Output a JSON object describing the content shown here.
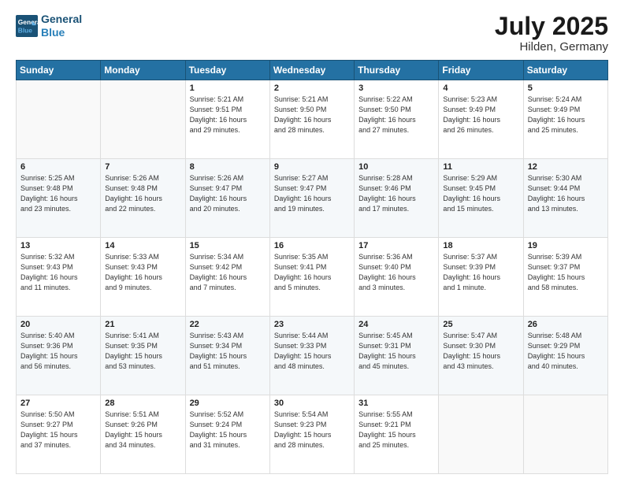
{
  "logo": {
    "line1": "General",
    "line2": "Blue"
  },
  "title": "July 2025",
  "location": "Hilden, Germany",
  "days_header": [
    "Sunday",
    "Monday",
    "Tuesday",
    "Wednesday",
    "Thursday",
    "Friday",
    "Saturday"
  ],
  "weeks": [
    [
      {
        "day": "",
        "content": ""
      },
      {
        "day": "",
        "content": ""
      },
      {
        "day": "1",
        "content": "Sunrise: 5:21 AM\nSunset: 9:51 PM\nDaylight: 16 hours\nand 29 minutes."
      },
      {
        "day": "2",
        "content": "Sunrise: 5:21 AM\nSunset: 9:50 PM\nDaylight: 16 hours\nand 28 minutes."
      },
      {
        "day": "3",
        "content": "Sunrise: 5:22 AM\nSunset: 9:50 PM\nDaylight: 16 hours\nand 27 minutes."
      },
      {
        "day": "4",
        "content": "Sunrise: 5:23 AM\nSunset: 9:49 PM\nDaylight: 16 hours\nand 26 minutes."
      },
      {
        "day": "5",
        "content": "Sunrise: 5:24 AM\nSunset: 9:49 PM\nDaylight: 16 hours\nand 25 minutes."
      }
    ],
    [
      {
        "day": "6",
        "content": "Sunrise: 5:25 AM\nSunset: 9:48 PM\nDaylight: 16 hours\nand 23 minutes."
      },
      {
        "day": "7",
        "content": "Sunrise: 5:26 AM\nSunset: 9:48 PM\nDaylight: 16 hours\nand 22 minutes."
      },
      {
        "day": "8",
        "content": "Sunrise: 5:26 AM\nSunset: 9:47 PM\nDaylight: 16 hours\nand 20 minutes."
      },
      {
        "day": "9",
        "content": "Sunrise: 5:27 AM\nSunset: 9:47 PM\nDaylight: 16 hours\nand 19 minutes."
      },
      {
        "day": "10",
        "content": "Sunrise: 5:28 AM\nSunset: 9:46 PM\nDaylight: 16 hours\nand 17 minutes."
      },
      {
        "day": "11",
        "content": "Sunrise: 5:29 AM\nSunset: 9:45 PM\nDaylight: 16 hours\nand 15 minutes."
      },
      {
        "day": "12",
        "content": "Sunrise: 5:30 AM\nSunset: 9:44 PM\nDaylight: 16 hours\nand 13 minutes."
      }
    ],
    [
      {
        "day": "13",
        "content": "Sunrise: 5:32 AM\nSunset: 9:43 PM\nDaylight: 16 hours\nand 11 minutes."
      },
      {
        "day": "14",
        "content": "Sunrise: 5:33 AM\nSunset: 9:43 PM\nDaylight: 16 hours\nand 9 minutes."
      },
      {
        "day": "15",
        "content": "Sunrise: 5:34 AM\nSunset: 9:42 PM\nDaylight: 16 hours\nand 7 minutes."
      },
      {
        "day": "16",
        "content": "Sunrise: 5:35 AM\nSunset: 9:41 PM\nDaylight: 16 hours\nand 5 minutes."
      },
      {
        "day": "17",
        "content": "Sunrise: 5:36 AM\nSunset: 9:40 PM\nDaylight: 16 hours\nand 3 minutes."
      },
      {
        "day": "18",
        "content": "Sunrise: 5:37 AM\nSunset: 9:39 PM\nDaylight: 16 hours\nand 1 minute."
      },
      {
        "day": "19",
        "content": "Sunrise: 5:39 AM\nSunset: 9:37 PM\nDaylight: 15 hours\nand 58 minutes."
      }
    ],
    [
      {
        "day": "20",
        "content": "Sunrise: 5:40 AM\nSunset: 9:36 PM\nDaylight: 15 hours\nand 56 minutes."
      },
      {
        "day": "21",
        "content": "Sunrise: 5:41 AM\nSunset: 9:35 PM\nDaylight: 15 hours\nand 53 minutes."
      },
      {
        "day": "22",
        "content": "Sunrise: 5:43 AM\nSunset: 9:34 PM\nDaylight: 15 hours\nand 51 minutes."
      },
      {
        "day": "23",
        "content": "Sunrise: 5:44 AM\nSunset: 9:33 PM\nDaylight: 15 hours\nand 48 minutes."
      },
      {
        "day": "24",
        "content": "Sunrise: 5:45 AM\nSunset: 9:31 PM\nDaylight: 15 hours\nand 45 minutes."
      },
      {
        "day": "25",
        "content": "Sunrise: 5:47 AM\nSunset: 9:30 PM\nDaylight: 15 hours\nand 43 minutes."
      },
      {
        "day": "26",
        "content": "Sunrise: 5:48 AM\nSunset: 9:29 PM\nDaylight: 15 hours\nand 40 minutes."
      }
    ],
    [
      {
        "day": "27",
        "content": "Sunrise: 5:50 AM\nSunset: 9:27 PM\nDaylight: 15 hours\nand 37 minutes."
      },
      {
        "day": "28",
        "content": "Sunrise: 5:51 AM\nSunset: 9:26 PM\nDaylight: 15 hours\nand 34 minutes."
      },
      {
        "day": "29",
        "content": "Sunrise: 5:52 AM\nSunset: 9:24 PM\nDaylight: 15 hours\nand 31 minutes."
      },
      {
        "day": "30",
        "content": "Sunrise: 5:54 AM\nSunset: 9:23 PM\nDaylight: 15 hours\nand 28 minutes."
      },
      {
        "day": "31",
        "content": "Sunrise: 5:55 AM\nSunset: 9:21 PM\nDaylight: 15 hours\nand 25 minutes."
      },
      {
        "day": "",
        "content": ""
      },
      {
        "day": "",
        "content": ""
      }
    ]
  ]
}
